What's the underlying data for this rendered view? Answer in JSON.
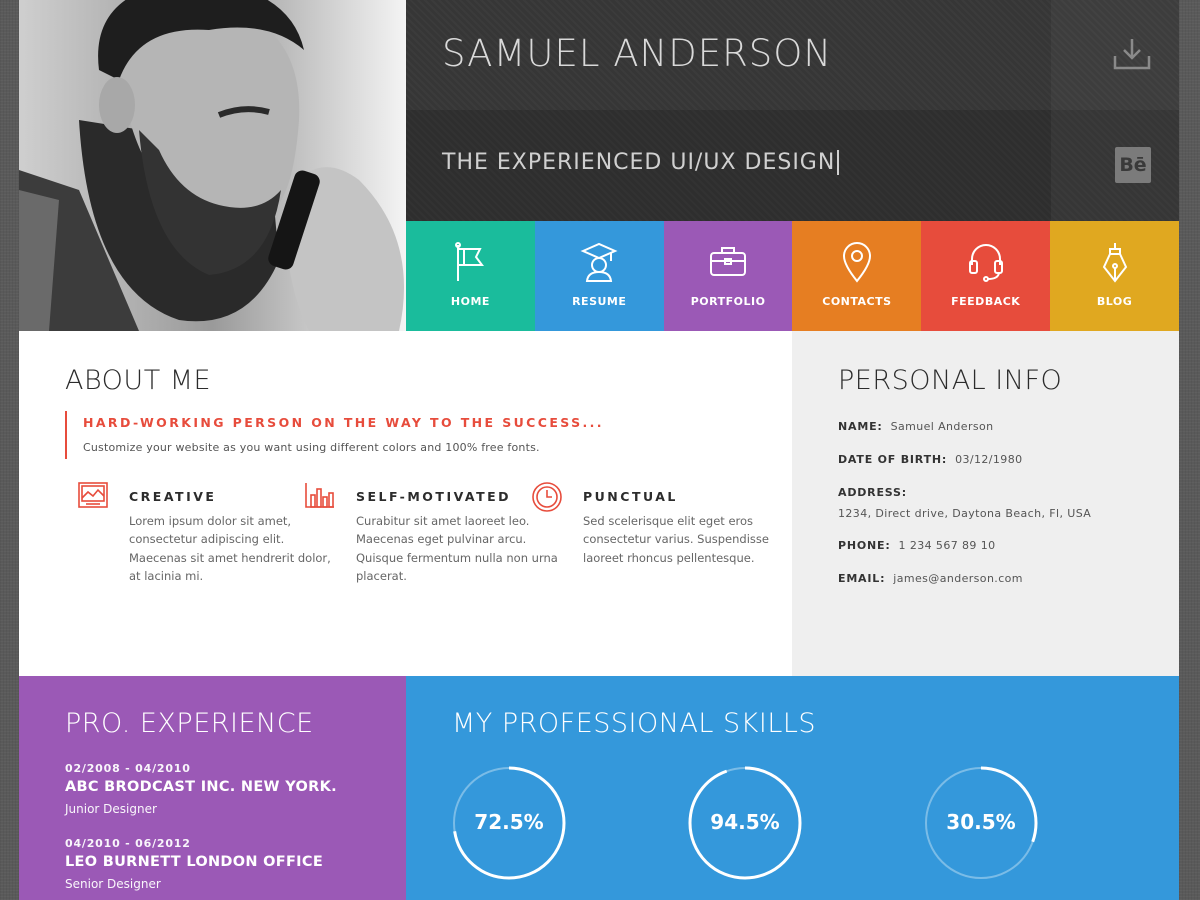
{
  "header": {
    "name": "SAMUEL ANDERSON",
    "title": "THE EXPERIENCED UI/UX DESIGN",
    "download_icon": "download-icon",
    "behance_label": "Bē"
  },
  "nav": {
    "items": [
      {
        "label": "HOME",
        "icon": "flag-icon",
        "color": "#1abc9c"
      },
      {
        "label": "RESUME",
        "icon": "graduate-icon",
        "color": "#3498db"
      },
      {
        "label": "PORTFOLIO",
        "icon": "briefcase-icon",
        "color": "#9b59b6"
      },
      {
        "label": "CONTACTS",
        "icon": "location-pin-icon",
        "color": "#e67e22"
      },
      {
        "label": "FEEDBACK",
        "icon": "headset-icon",
        "color": "#e74c3c"
      },
      {
        "label": "BLOG",
        "icon": "pen-nib-icon",
        "color": "#e5a823"
      }
    ]
  },
  "about": {
    "heading": "ABOUT ME",
    "tagline": "HARD-WORKING PERSON ON THE WAY TO THE SUCCESS...",
    "description": "Customize your website as you want using different colors and 100% free fonts.",
    "features": [
      {
        "title": "CREATIVE",
        "icon": "image-icon",
        "text": "Lorem ipsum dolor sit amet, consectetur adipiscing elit. Maecenas sit amet hendrerit dolor, at lacinia mi."
      },
      {
        "title": "SELF-MOTIVATED",
        "icon": "bar-chart-icon",
        "text": "Curabitur sit amet laoreet leo. Maecenas eget pulvinar arcu. Quisque fermentum nulla non urna placerat."
      },
      {
        "title": "PUNCTUAL",
        "icon": "clock-icon",
        "text": "Sed scelerisque elit eget eros consectetur varius. Suspendisse laoreet rhoncus pellentesque."
      }
    ],
    "accent_color": "#e74c3c"
  },
  "personal_info": {
    "heading": "PERSONAL INFO",
    "name_label": "NAME:",
    "name_value": "Samuel Anderson",
    "dob_label": "DATE OF BIRTH:",
    "dob_value": "03/12/1980",
    "address_label": "ADDRESS:",
    "address_value": "1234, Direct drive, Daytona Beach, Fl, USA",
    "phone_label": "PHONE:",
    "phone_value": "1 234 567 89 10",
    "email_label": "EMAIL:",
    "email_value": "james@anderson.com"
  },
  "experience": {
    "heading": "PRO. EXPERIENCE",
    "jobs": [
      {
        "dates": "02/2008 - 04/2010",
        "company": "ABC BRODCAST INC. NEW YORK.",
        "role": "Junior Designer"
      },
      {
        "dates": "04/2010 - 06/2012",
        "company": "LEO BURNETT LONDON OFFICE",
        "role": "Senior Designer"
      }
    ]
  },
  "skills": {
    "heading": "MY PROFESSIONAL SKILLS",
    "items": [
      {
        "value": "72.5%",
        "fraction": 0.725
      },
      {
        "value": "94.5%",
        "fraction": 0.945
      },
      {
        "value": "30.5%",
        "fraction": 0.305
      }
    ]
  }
}
